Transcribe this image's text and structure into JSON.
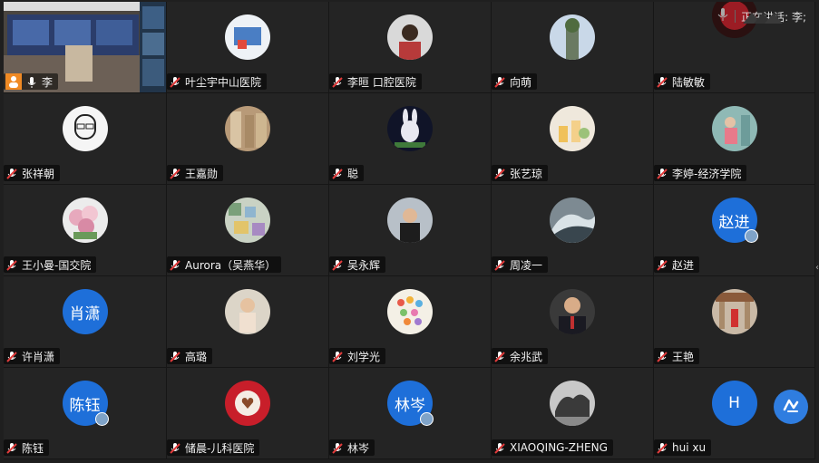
{
  "header": {
    "speaking_label": "正在讲话: 李;"
  },
  "colors": {
    "tile_bg": "#242424",
    "letter_avatar_bg": "#1e6fd9",
    "name_text": "#f2f2f2"
  },
  "participants": [
    {
      "name": "李",
      "avatar": "screen-share",
      "mic": "active"
    },
    {
      "name": "叶尘宇中山医院",
      "avatar": "photo",
      "mic": "muted"
    },
    {
      "name": "李晅 口腔医院",
      "avatar": "photo",
      "mic": "muted"
    },
    {
      "name": "向萌",
      "avatar": "photo",
      "mic": "muted"
    },
    {
      "name": "陆敏敏",
      "avatar": "photo",
      "mic": "muted"
    },
    {
      "name": "张祥朝",
      "avatar": "photo",
      "mic": "muted"
    },
    {
      "name": "王嘉勋",
      "avatar": "photo",
      "mic": "muted"
    },
    {
      "name": "聪",
      "avatar": "photo",
      "mic": "muted"
    },
    {
      "name": "张艺琼",
      "avatar": "photo",
      "mic": "muted"
    },
    {
      "name": "李婷-经济学院",
      "avatar": "photo",
      "mic": "muted"
    },
    {
      "name": "王小曼-国交院",
      "avatar": "photo",
      "mic": "muted"
    },
    {
      "name": "Aurora（吴燕华）",
      "avatar": "photo",
      "mic": "muted"
    },
    {
      "name": "吴永辉",
      "avatar": "photo",
      "mic": "muted"
    },
    {
      "name": "周凌一",
      "avatar": "photo",
      "mic": "muted"
    },
    {
      "name": "赵进",
      "avatar": "letter",
      "avatar_text": "赵进",
      "mic": "muted"
    },
    {
      "name": "许肖潇",
      "avatar": "letter",
      "avatar_text": "肖潇",
      "mic": "muted"
    },
    {
      "name": "高璐",
      "avatar": "photo",
      "mic": "muted"
    },
    {
      "name": "刘学光",
      "avatar": "photo",
      "mic": "muted"
    },
    {
      "name": "余兆武",
      "avatar": "photo",
      "mic": "muted"
    },
    {
      "name": "王艳",
      "avatar": "photo",
      "mic": "muted"
    },
    {
      "name": "陈钰",
      "avatar": "letter",
      "avatar_text": "陈钰",
      "mic": "muted"
    },
    {
      "name": "储晨-儿科医院",
      "avatar": "photo",
      "mic": "muted"
    },
    {
      "name": "林岑",
      "avatar": "letter",
      "avatar_text": "林岑",
      "mic": "muted"
    },
    {
      "name": "XIAOQING-ZHENG",
      "avatar": "photo",
      "mic": "muted"
    },
    {
      "name": "hui xu",
      "avatar": "letter",
      "avatar_text": "H",
      "mic": "muted"
    }
  ]
}
